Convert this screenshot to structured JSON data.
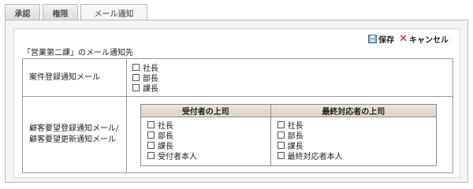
{
  "tabs": [
    {
      "label": "承認"
    },
    {
      "label": "権限"
    },
    {
      "label": "メール通知"
    }
  ],
  "toolbar": {
    "save_label": "保存",
    "cancel_label": "キャンセル"
  },
  "section_title": "「営業第二課」のメール通知先",
  "rows": {
    "case_registration": {
      "label": "案件登録通知メール",
      "options": [
        "社長",
        "部長",
        "課長"
      ]
    },
    "customer_request": {
      "label_line1": "顧客要望登録通知メール/",
      "label_line2": "顧客要望更新通知メール",
      "columns": [
        {
          "header": "受付者の上司",
          "options": [
            "社長",
            "部長",
            "課長",
            "受付者本人"
          ]
        },
        {
          "header": "最終対応者の上司",
          "options": [
            "社長",
            "部長",
            "課長",
            "最終対応者本人"
          ]
        }
      ]
    }
  }
}
